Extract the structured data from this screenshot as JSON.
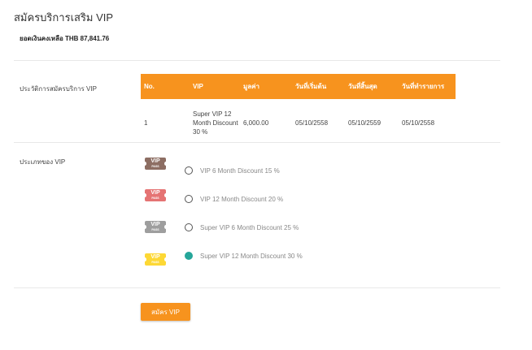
{
  "page": {
    "title": "สมัครบริการเสริม VIP"
  },
  "balance": {
    "text": "ยอดเงินคงเหลือ THB 87,841.76"
  },
  "history": {
    "label": "ประวัติการสมัครบริการ VIP",
    "headers": [
      "No.",
      "VIP",
      "มูลค่า",
      "วันที่เริ่มต้น",
      "วันที่สิ้นสุด",
      "วันที่ทำรายการ"
    ],
    "rows": [
      {
        "no": "1",
        "vip": "Super VIP 12 Month Discount 30 %",
        "value": "6,000.00",
        "start": "05/10/2558",
        "end": "05/10/2559",
        "txn": "05/10/2558"
      }
    ]
  },
  "vip_types": {
    "label": "ประเภทของ VIP",
    "options": [
      {
        "label": "VIP 6 Month Discount 15 %",
        "ticket_top": "VIP",
        "ticket_bottom": "PASS",
        "color": "#8d6e63",
        "selected": false
      },
      {
        "label": "VIP 12 Month Discount 20 %",
        "ticket_top": "VIP",
        "ticket_bottom": "PASS",
        "color": "#e57373",
        "selected": false
      },
      {
        "label": "Super VIP 6 Month Discount 25 %",
        "ticket_top": "VIP",
        "ticket_bottom": "PASS",
        "color": "#9e9e9e",
        "selected": false
      },
      {
        "label": "Super VIP 12 Month Discount 30 %",
        "ticket_top": "VIP",
        "ticket_bottom": "PASS",
        "color": "#fdd835",
        "selected": true
      }
    ]
  },
  "submit": {
    "label": "สมัคร VIP"
  },
  "colors": {
    "accent": "#f7931e",
    "selected_radio": "#26a69a"
  }
}
